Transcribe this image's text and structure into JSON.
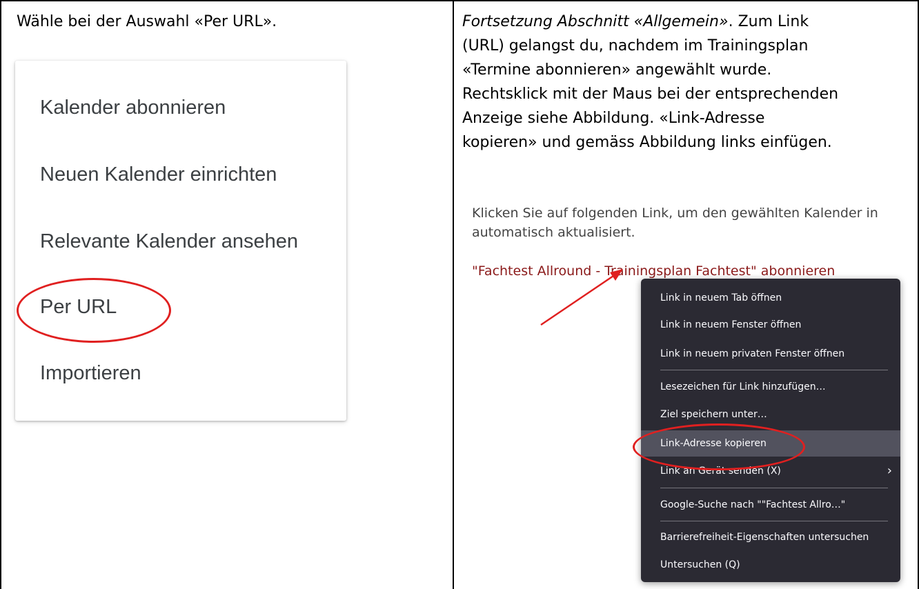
{
  "left_cell": {
    "instruction": "Wähle bei der Auswahl «Per URL».",
    "menu": {
      "items": [
        "Kalender abonnieren",
        "Neuen Kalender einrichten",
        "Relevante Kalender ansehen",
        "Per URL",
        "Importieren"
      ]
    }
  },
  "right_cell": {
    "instruction_italic": "Fortsetzung Abschnitt «Allgemein»",
    "instruction_lines": [
      "Fortsetzung Abschnitt «Allgemein». Zum Link",
      "(URL) gelangst du, nachdem im Trainingsplan",
      "«Termine abonnieren» angewählt wurde.",
      "Rechtsklick mit der Maus bei der entsprechenden",
      "Anzeige siehe Abbildung. «Link-Adresse",
      "kopieren» und gemäss Abbildung links einfügen."
    ],
    "line1_rest": ". Zum Link",
    "web": {
      "text_line1": "Klicken Sie auf folgenden Link, um den gewählten Kalender in",
      "text_line2": "automatisch aktualisiert.",
      "link": "\"Fachtest Allround - Trainingsplan Fachtest\" abonnieren"
    },
    "context_menu": {
      "items": [
        "Link in neuem Tab öffnen",
        "Link in neuem Fenster öffnen",
        "Link in neuem privaten Fenster öffnen",
        "Lesezeichen für Link hinzufügen…",
        "Ziel speichern unter…",
        "Link-Adresse kopieren",
        "Link an Gerät senden (X)",
        "Google-Suche nach \"\"Fachtest Allro…\"",
        "Barrierefreiheit-Eigenschaften untersuchen",
        "Untersuchen (Q)"
      ],
      "highlighted_index": 5,
      "colors": {
        "background": "#2b2a33",
        "highlight": "#52525e",
        "text": "#fbfbfe"
      }
    },
    "annotation_color": "#e02020"
  }
}
